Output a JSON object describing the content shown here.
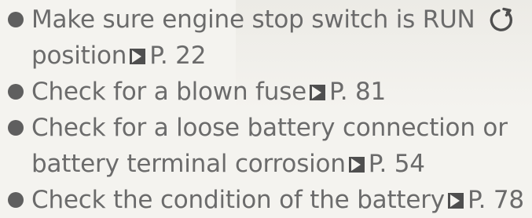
{
  "items": [
    {
      "line1": "Make sure engine stop switch is RUN",
      "line2_text": "position",
      "line2_ref": "P. 22",
      "symbol_icon": "run-position-icon"
    },
    {
      "text": "Check for a blown fuse",
      "ref": "P. 81"
    },
    {
      "line1": "Check for a loose battery connection or",
      "line2_text": "battery terminal corrosion",
      "line2_ref": "P. 54"
    },
    {
      "text": "Check the condition of the battery",
      "ref": "P. 78"
    }
  ],
  "icons": {
    "bullet": "bullet-icon",
    "page_reference": "page-reference-icon"
  }
}
